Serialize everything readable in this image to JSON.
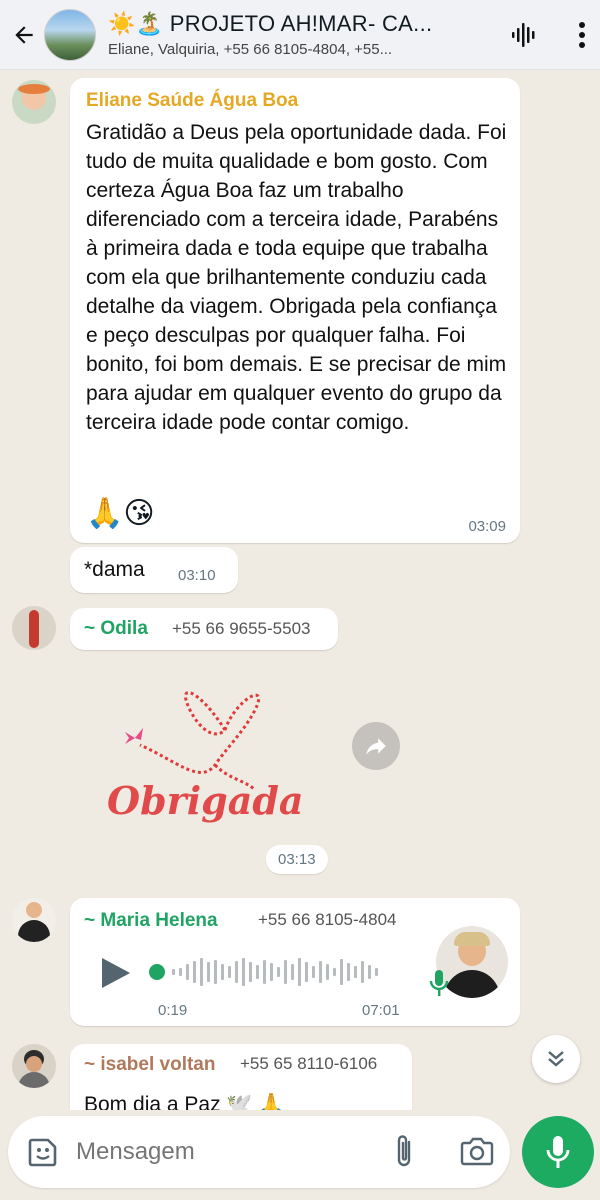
{
  "header": {
    "title": "☀️🏝️ PROJETO AH!MAR- CA...",
    "subtitle": "Eliane, Valquiria, +55 66 8105-4804, +55..."
  },
  "messages": {
    "m1": {
      "sender": "Eliane Saúde Água Boa",
      "sender_color": "#e5a823",
      "text": "Gratidão a Deus pela oportunidade dada. Foi tudo de muita qualidade e bom gosto. Com certeza Água Boa faz um trabalho diferenciado com a terceira idade, Parabéns à primeira dada e toda equipe que trabalha com ela que brilhantemente conduziu cada detalhe da viagem. Obrigada pela confiança e peço desculpas por qualquer falha. Foi bonito, foi bom demais. E se precisar de mim para ajudar em qualquer evento do grupo da terceira idade pode contar comigo.",
      "emojis": "🙏😘",
      "time": "03:09"
    },
    "m2": {
      "text": "*dama",
      "time": "03:10"
    },
    "m3": {
      "sender": "~ Odila",
      "sender_color": "#1fa463",
      "phone": "+55 66 9655-5503",
      "sticker_text": "Obrigada",
      "time": "03:13"
    },
    "m4": {
      "sender": "~ Maria Helena",
      "sender_color": "#1fa463",
      "phone": "+55 66 8105-4804",
      "elapsed": "0:19",
      "time": "07:01"
    },
    "m5": {
      "sender": "~ isabel voltan",
      "sender_color": "#b07a5a",
      "phone": "+55 65 8110-6106",
      "text": "Bom dia a Paz 🕊️ 🙏"
    }
  },
  "input": {
    "placeholder": "Mensagem"
  },
  "colors": {
    "accent": "#1daa61",
    "chat_bg": "#efeae2"
  }
}
